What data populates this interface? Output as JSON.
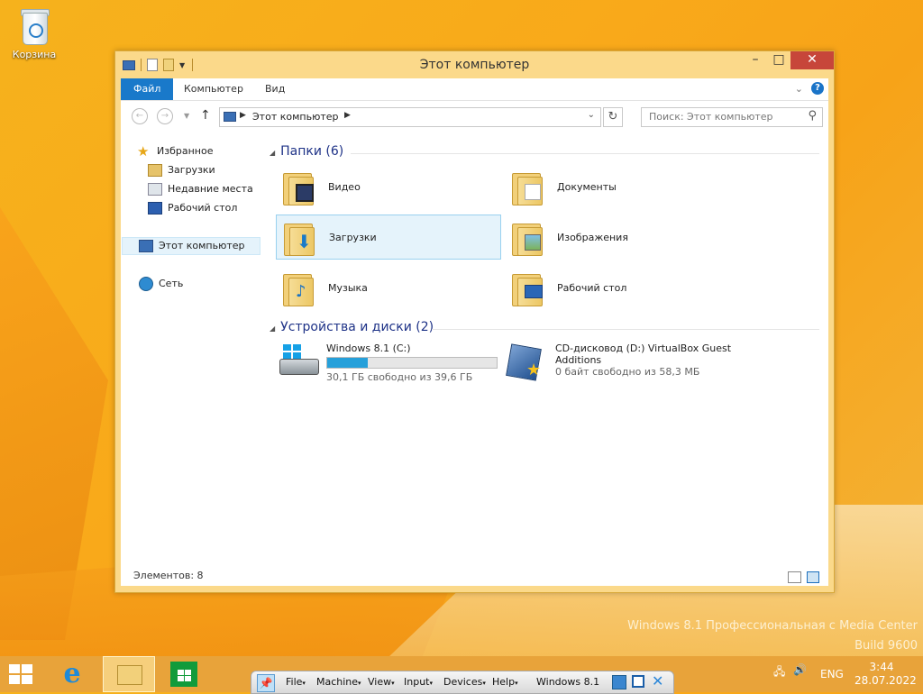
{
  "desktop": {
    "recycle_bin_label": "Корзина",
    "watermark_line1": "Windows 8.1 Профессиональная с Media Center",
    "watermark_line2": "Build 9600"
  },
  "window": {
    "title": "Этот компьютер",
    "controls": {
      "minimize": "–",
      "maximize": "□",
      "close": "✕"
    }
  },
  "ribbon": {
    "tabs": [
      {
        "label": "Файл"
      },
      {
        "label": "Компьютер"
      },
      {
        "label": "Вид"
      }
    ],
    "expand": "⌄",
    "help": "?"
  },
  "address": {
    "path": "Этот компьютер",
    "search_placeholder": "Поиск: Этот компьютер"
  },
  "nav_pane": {
    "favorites": "Избранное",
    "downloads": "Загрузки",
    "recent": "Недавние места",
    "desktop": "Рабочий стол",
    "this_pc": "Этот компьютер",
    "network": "Сеть"
  },
  "content": {
    "folders_header": "Папки (6)",
    "folders": [
      {
        "name": "Видео",
        "icon": "video-folder-icon"
      },
      {
        "name": "Документы",
        "icon": "documents-folder-icon"
      },
      {
        "name": "Загрузки",
        "icon": "downloads-folder-icon"
      },
      {
        "name": "Изображения",
        "icon": "pictures-folder-icon"
      },
      {
        "name": "Музыка",
        "icon": "music-folder-icon"
      },
      {
        "name": "Рабочий стол",
        "icon": "desktop-folder-icon"
      }
    ],
    "drives_header": "Устройства и диски (2)",
    "drives": [
      {
        "name": "Windows 8.1 (C:)",
        "free": "30,1 ГБ свободно из 39,6 ГБ",
        "used_fraction": 0.24,
        "icon": "hard-drive-icon"
      },
      {
        "name_line1": "CD-дисковод (D:) VirtualBox Guest",
        "name_line2": "Additions",
        "free": "0 байт свободно из 58,3 МБ",
        "icon": "virtualbox-cd-icon"
      }
    ]
  },
  "status_bar": {
    "items_count": "Элементов: 8"
  },
  "vbox_menu": {
    "items": [
      {
        "label": "File"
      },
      {
        "label": "Machine"
      },
      {
        "label": "View"
      },
      {
        "label": "Input"
      },
      {
        "label": "Devices"
      },
      {
        "label": "Help"
      }
    ],
    "title": "Windows 8.1"
  },
  "tray": {
    "lang": "ENG",
    "time": "3:44",
    "date": "28.07.2022"
  },
  "colors": {
    "accent": "#1979ca",
    "close": "#c7463a",
    "taskbar": "#e8a33a",
    "progress": "#26a0da"
  }
}
